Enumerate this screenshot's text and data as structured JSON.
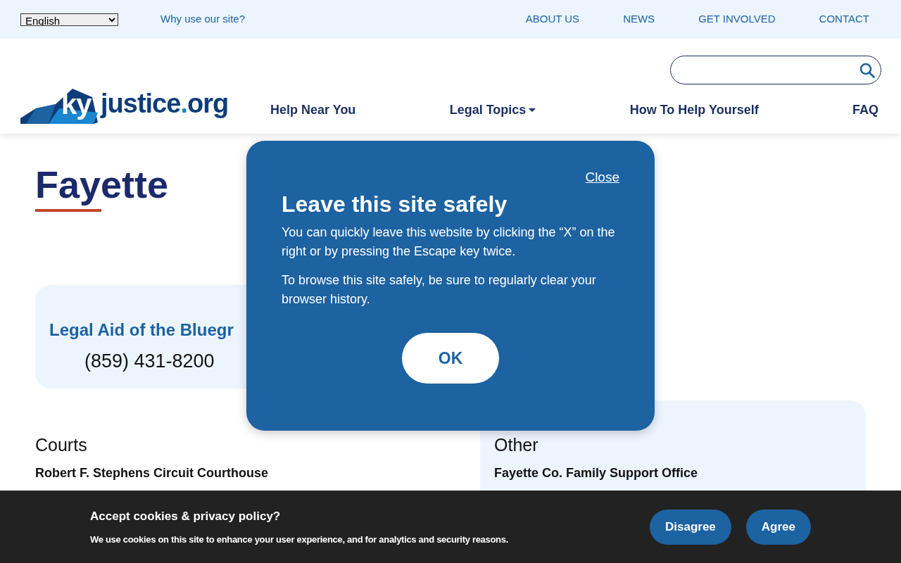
{
  "top_bar": {
    "language": "English",
    "why_link": "Why use our site?",
    "links": [
      "ABOUT US",
      "NEWS",
      "GET INVOLVED",
      "CONTACT"
    ]
  },
  "header": {
    "logo": {
      "mark": "ky",
      "word": "justice",
      "dot": ".",
      "tld": "org"
    },
    "nav": [
      {
        "label": "Help Near You",
        "dropdown": false
      },
      {
        "label": "Legal Topics",
        "dropdown": true
      },
      {
        "label": "How To Help Yourself",
        "dropdown": false
      },
      {
        "label": "FAQ",
        "dropdown": false
      }
    ]
  },
  "page_title": "Fayette",
  "provider": {
    "name": "Legal Aid of the Bluegr",
    "phone": "(859) 431-8200"
  },
  "sections": [
    {
      "heading": "Courts",
      "highlighted": false,
      "name": "Robert F. Stephens Circuit Courthouse"
    },
    {
      "heading": "Other",
      "highlighted": true,
      "name": "Fayette Co. Family Support Office"
    }
  ],
  "modal": {
    "close": "Close",
    "title": "Leave this site safely",
    "paragraphs": [
      "You can quickly leave this website by clicking the “X” on the right or by pressing the Escape key twice.",
      "To browse this site safely, be sure to regularly clear your browser history."
    ],
    "button": "OK"
  },
  "cookie_banner": {
    "title": "Accept cookies & privacy policy?",
    "text": "We use cookies on this site to enhance your user experience, and for analytics and security reasons.",
    "buttons": [
      "Disagree",
      "Agree"
    ]
  }
}
